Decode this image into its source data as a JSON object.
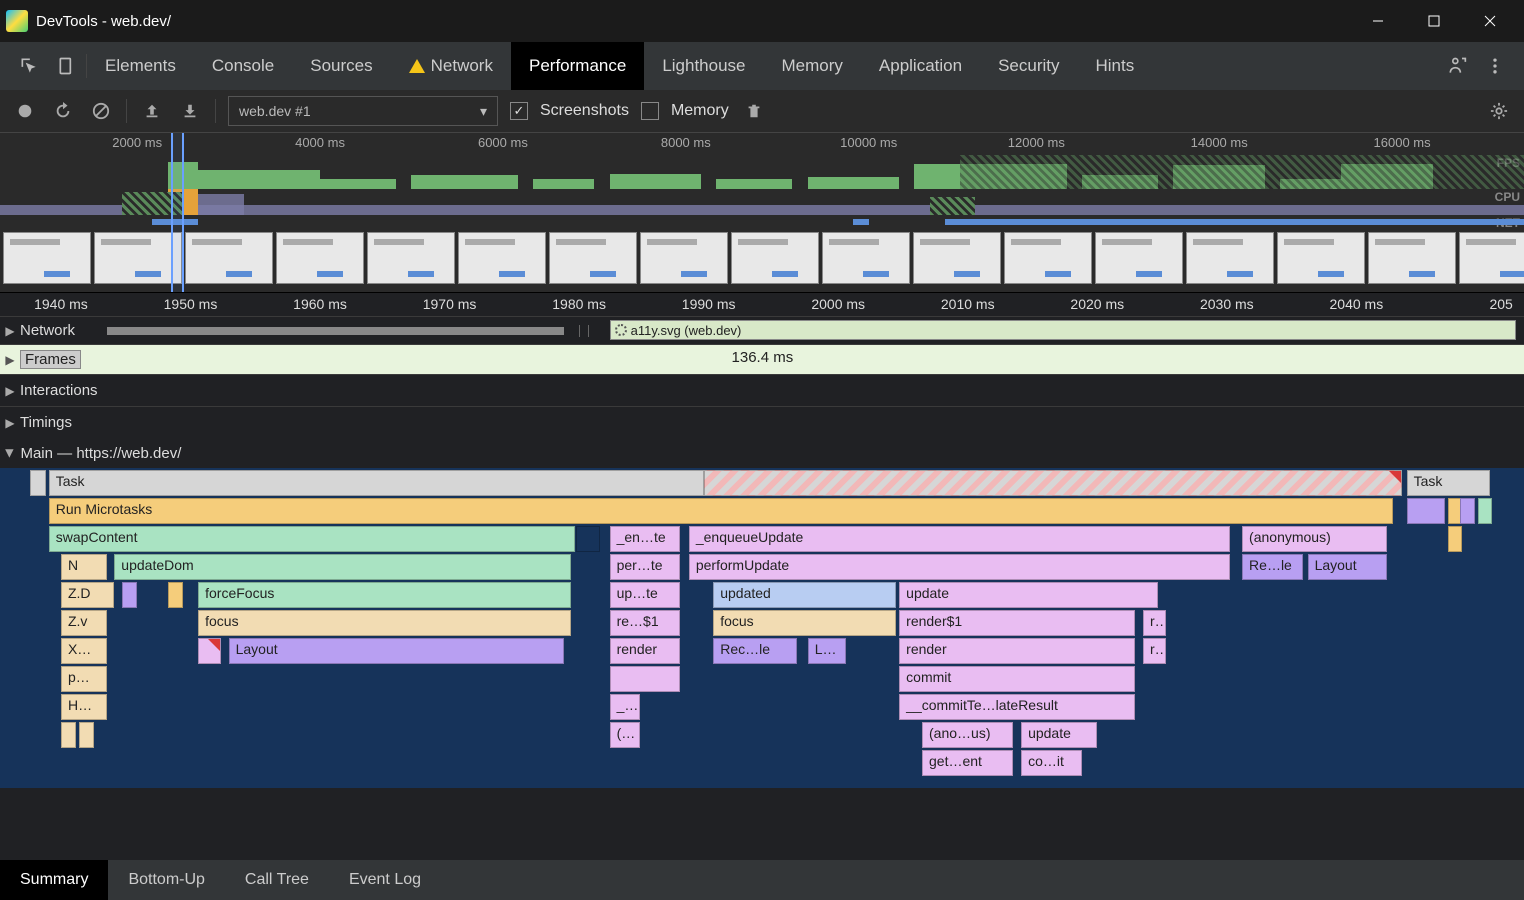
{
  "window": {
    "title": "DevTools - web.dev/"
  },
  "tabs": {
    "elements": "Elements",
    "console": "Console",
    "sources": "Sources",
    "network": "Network",
    "performance": "Performance",
    "lighthouse": "Lighthouse",
    "memory": "Memory",
    "application": "Application",
    "security": "Security",
    "hints": "Hints"
  },
  "toolbar": {
    "profile": "web.dev #1",
    "screenshots_label": "Screenshots",
    "memory_label": "Memory"
  },
  "overview": {
    "ticks": [
      "2000 ms",
      "4000 ms",
      "6000 ms",
      "8000 ms",
      "10000 ms",
      "12000 ms",
      "14000 ms",
      "16000 ms"
    ],
    "fps_label": "FPS",
    "cpu_label": "CPU",
    "net_label": "NET"
  },
  "detail": {
    "ticks": [
      "1940 ms",
      "1950 ms",
      "1960 ms",
      "1970 ms",
      "1980 ms",
      "1990 ms",
      "2000 ms",
      "2010 ms",
      "2020 ms",
      "2030 ms",
      "2040 ms",
      "205"
    ],
    "network_label": "Network",
    "network_item": "a11y.svg (web.dev)",
    "frames_label": "Frames",
    "frames_value": "136.4 ms",
    "interactions_label": "Interactions",
    "timings_label": "Timings",
    "main_label": "Main — https://web.dev/"
  },
  "flame": {
    "task": "Task",
    "task2": "Task",
    "run_microtasks": "Run Microtasks",
    "swapContent": "swapContent",
    "en_te": "_en…te",
    "enqueueUpdate": "_enqueueUpdate",
    "anonymous": "(anonymous)",
    "N": "N",
    "updateDom": "updateDom",
    "per_te": "per…te",
    "performUpdate": "performUpdate",
    "re_le": "Re…le",
    "layout2": "Layout",
    "ZD": "Z.D",
    "forceFocus": "forceFocus",
    "up_te": "up…te",
    "updated": "updated",
    "update": "update",
    "Zv": "Z.v",
    "focus": "focus",
    "re_1": "re…$1",
    "focus2": "focus",
    "render_1": "render$1",
    "r": "r…",
    "X": "X…",
    "layout": "Layout",
    "render": "render",
    "rec_le": "Rec…le",
    "L": "L…",
    "render2": "render",
    "r2": "r…",
    "p": "p…",
    "commit": "commit",
    "H": "H…",
    "dash": "_…",
    "commitTemplate": "__commitTe…lateResult",
    "paren": "(…",
    "ano_us": "(ano…us)",
    "update2": "update",
    "get_ent": "get…ent",
    "co_it": "co…it"
  },
  "bottom_tabs": {
    "summary": "Summary",
    "bottomup": "Bottom-Up",
    "calltree": "Call Tree",
    "eventlog": "Event Log"
  }
}
